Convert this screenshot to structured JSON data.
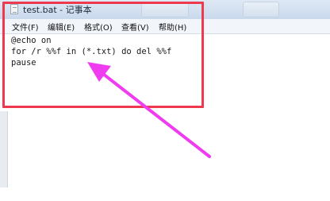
{
  "window": {
    "title": "test.bat - 记事本",
    "icon": "notepad-icon"
  },
  "menu": {
    "items": [
      "文件(F)",
      "编辑(E)",
      "格式(O)",
      "查看(V)",
      "帮助(H)"
    ]
  },
  "editor": {
    "lines": [
      "@echo on",
      "for /r %%f in (*.txt) do del %%f",
      "pause"
    ]
  },
  "annotation": {
    "box_color": "#ee3a4f",
    "arrow_color": "#f03cf0"
  }
}
